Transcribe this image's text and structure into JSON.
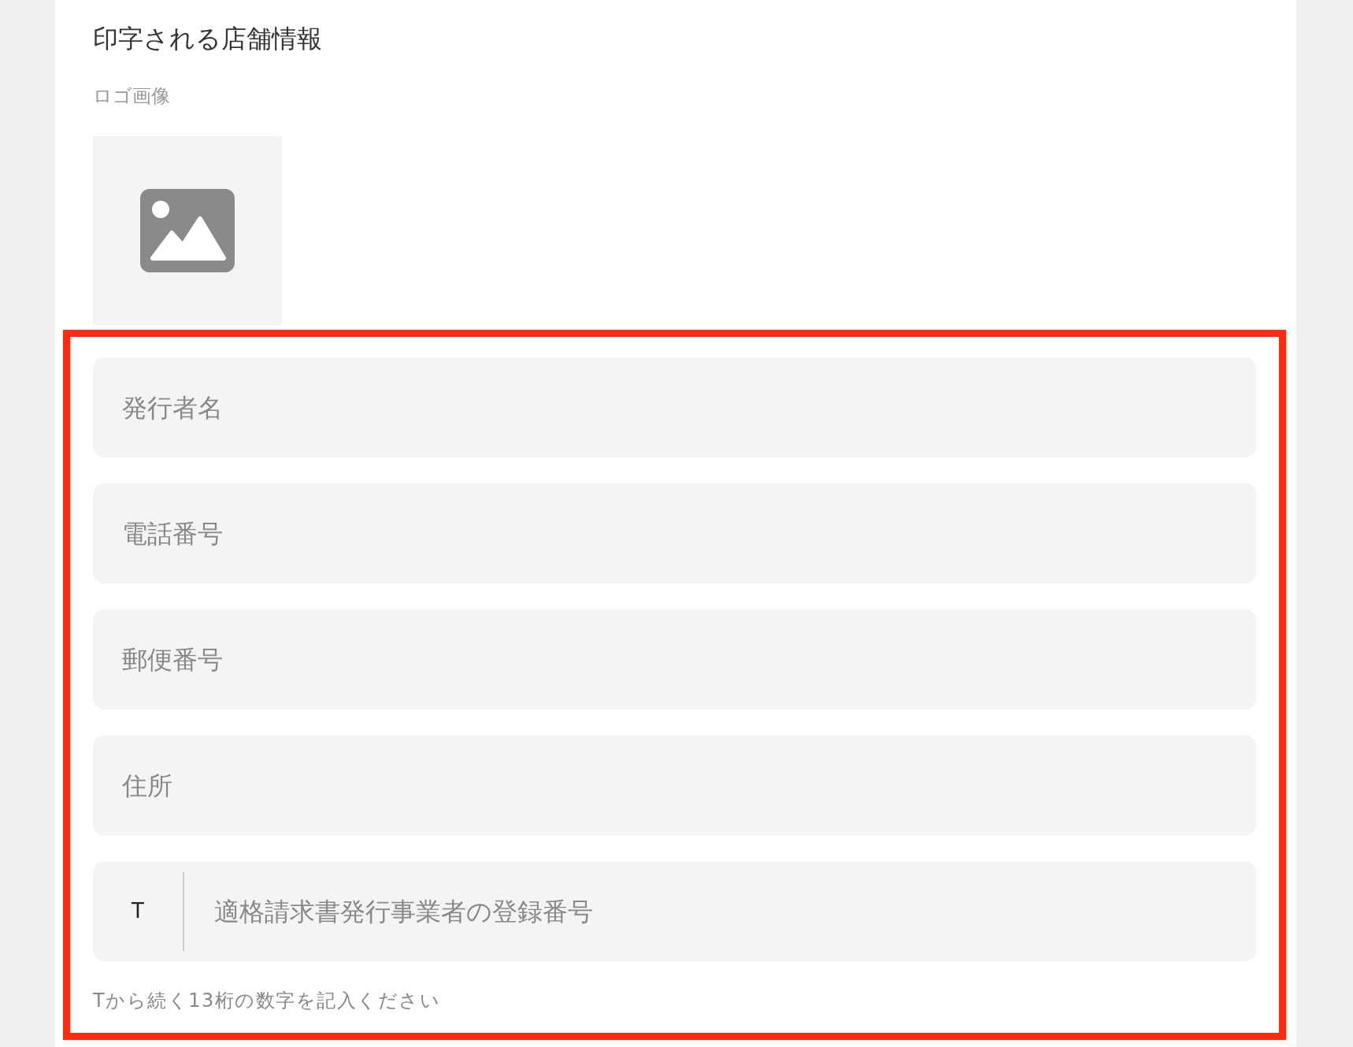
{
  "section_title": "印字される店舗情報",
  "logo": {
    "label": "ロゴ画像"
  },
  "form": {
    "highlighted": true,
    "fields": [
      {
        "kind": "text",
        "placeholder": "発行者名"
      },
      {
        "kind": "text",
        "placeholder": "電話番号"
      },
      {
        "kind": "text",
        "placeholder": "郵便番号"
      },
      {
        "kind": "text",
        "placeholder": "住所"
      },
      {
        "kind": "prefixed",
        "prefix": "T",
        "placeholder": "適格請求書発行事業者の登録番号"
      }
    ],
    "help_text": "Tから続く13桁の数字を記入ください"
  }
}
